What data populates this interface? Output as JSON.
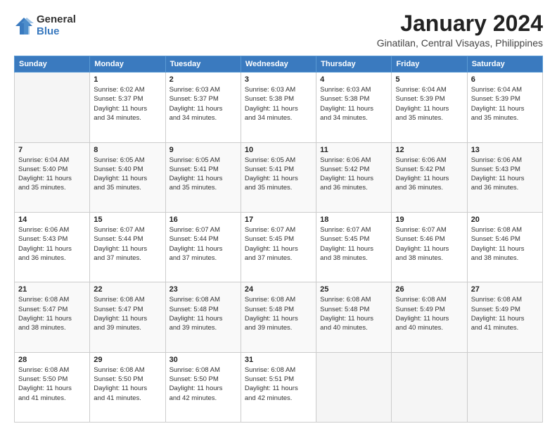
{
  "logo": {
    "general": "General",
    "blue": "Blue"
  },
  "title": "January 2024",
  "subtitle": "Ginatilan, Central Visayas, Philippines",
  "days_header": [
    "Sunday",
    "Monday",
    "Tuesday",
    "Wednesday",
    "Thursday",
    "Friday",
    "Saturday"
  ],
  "weeks": [
    [
      {
        "num": "",
        "info": ""
      },
      {
        "num": "1",
        "info": "Sunrise: 6:02 AM\nSunset: 5:37 PM\nDaylight: 11 hours\nand 34 minutes."
      },
      {
        "num": "2",
        "info": "Sunrise: 6:03 AM\nSunset: 5:37 PM\nDaylight: 11 hours\nand 34 minutes."
      },
      {
        "num": "3",
        "info": "Sunrise: 6:03 AM\nSunset: 5:38 PM\nDaylight: 11 hours\nand 34 minutes."
      },
      {
        "num": "4",
        "info": "Sunrise: 6:03 AM\nSunset: 5:38 PM\nDaylight: 11 hours\nand 34 minutes."
      },
      {
        "num": "5",
        "info": "Sunrise: 6:04 AM\nSunset: 5:39 PM\nDaylight: 11 hours\nand 35 minutes."
      },
      {
        "num": "6",
        "info": "Sunrise: 6:04 AM\nSunset: 5:39 PM\nDaylight: 11 hours\nand 35 minutes."
      }
    ],
    [
      {
        "num": "7",
        "info": "Sunrise: 6:04 AM\nSunset: 5:40 PM\nDaylight: 11 hours\nand 35 minutes."
      },
      {
        "num": "8",
        "info": "Sunrise: 6:05 AM\nSunset: 5:40 PM\nDaylight: 11 hours\nand 35 minutes."
      },
      {
        "num": "9",
        "info": "Sunrise: 6:05 AM\nSunset: 5:41 PM\nDaylight: 11 hours\nand 35 minutes."
      },
      {
        "num": "10",
        "info": "Sunrise: 6:05 AM\nSunset: 5:41 PM\nDaylight: 11 hours\nand 35 minutes."
      },
      {
        "num": "11",
        "info": "Sunrise: 6:06 AM\nSunset: 5:42 PM\nDaylight: 11 hours\nand 36 minutes."
      },
      {
        "num": "12",
        "info": "Sunrise: 6:06 AM\nSunset: 5:42 PM\nDaylight: 11 hours\nand 36 minutes."
      },
      {
        "num": "13",
        "info": "Sunrise: 6:06 AM\nSunset: 5:43 PM\nDaylight: 11 hours\nand 36 minutes."
      }
    ],
    [
      {
        "num": "14",
        "info": "Sunrise: 6:06 AM\nSunset: 5:43 PM\nDaylight: 11 hours\nand 36 minutes."
      },
      {
        "num": "15",
        "info": "Sunrise: 6:07 AM\nSunset: 5:44 PM\nDaylight: 11 hours\nand 37 minutes."
      },
      {
        "num": "16",
        "info": "Sunrise: 6:07 AM\nSunset: 5:44 PM\nDaylight: 11 hours\nand 37 minutes."
      },
      {
        "num": "17",
        "info": "Sunrise: 6:07 AM\nSunset: 5:45 PM\nDaylight: 11 hours\nand 37 minutes."
      },
      {
        "num": "18",
        "info": "Sunrise: 6:07 AM\nSunset: 5:45 PM\nDaylight: 11 hours\nand 38 minutes."
      },
      {
        "num": "19",
        "info": "Sunrise: 6:07 AM\nSunset: 5:46 PM\nDaylight: 11 hours\nand 38 minutes."
      },
      {
        "num": "20",
        "info": "Sunrise: 6:08 AM\nSunset: 5:46 PM\nDaylight: 11 hours\nand 38 minutes."
      }
    ],
    [
      {
        "num": "21",
        "info": "Sunrise: 6:08 AM\nSunset: 5:47 PM\nDaylight: 11 hours\nand 38 minutes."
      },
      {
        "num": "22",
        "info": "Sunrise: 6:08 AM\nSunset: 5:47 PM\nDaylight: 11 hours\nand 39 minutes."
      },
      {
        "num": "23",
        "info": "Sunrise: 6:08 AM\nSunset: 5:48 PM\nDaylight: 11 hours\nand 39 minutes."
      },
      {
        "num": "24",
        "info": "Sunrise: 6:08 AM\nSunset: 5:48 PM\nDaylight: 11 hours\nand 39 minutes."
      },
      {
        "num": "25",
        "info": "Sunrise: 6:08 AM\nSunset: 5:48 PM\nDaylight: 11 hours\nand 40 minutes."
      },
      {
        "num": "26",
        "info": "Sunrise: 6:08 AM\nSunset: 5:49 PM\nDaylight: 11 hours\nand 40 minutes."
      },
      {
        "num": "27",
        "info": "Sunrise: 6:08 AM\nSunset: 5:49 PM\nDaylight: 11 hours\nand 41 minutes."
      }
    ],
    [
      {
        "num": "28",
        "info": "Sunrise: 6:08 AM\nSunset: 5:50 PM\nDaylight: 11 hours\nand 41 minutes."
      },
      {
        "num": "29",
        "info": "Sunrise: 6:08 AM\nSunset: 5:50 PM\nDaylight: 11 hours\nand 41 minutes."
      },
      {
        "num": "30",
        "info": "Sunrise: 6:08 AM\nSunset: 5:50 PM\nDaylight: 11 hours\nand 42 minutes."
      },
      {
        "num": "31",
        "info": "Sunrise: 6:08 AM\nSunset: 5:51 PM\nDaylight: 11 hours\nand 42 minutes."
      },
      {
        "num": "",
        "info": ""
      },
      {
        "num": "",
        "info": ""
      },
      {
        "num": "",
        "info": ""
      }
    ]
  ]
}
